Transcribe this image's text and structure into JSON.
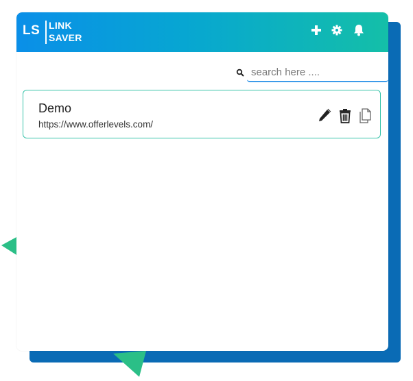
{
  "app": {
    "logo_short": "LS",
    "logo_line1": "LINK",
    "logo_line2": "SAVER",
    "colors": {
      "header_start": "#0a8fe8",
      "header_end": "#14bfa8",
      "accent_border": "#35c2a8",
      "shadow_card": "#0a6bb5",
      "triangle": "#2bbf87"
    }
  },
  "header": {
    "buttons": [
      {
        "icon": "plus-icon"
      },
      {
        "icon": "gear-icon"
      },
      {
        "icon": "bell-icon"
      }
    ]
  },
  "search": {
    "placeholder": "search here ....",
    "value": ""
  },
  "links": [
    {
      "title": "Demo",
      "url": "https://www.offerlevels.com/",
      "actions": [
        "edit-icon",
        "delete-icon",
        "copy-icon"
      ]
    }
  ]
}
